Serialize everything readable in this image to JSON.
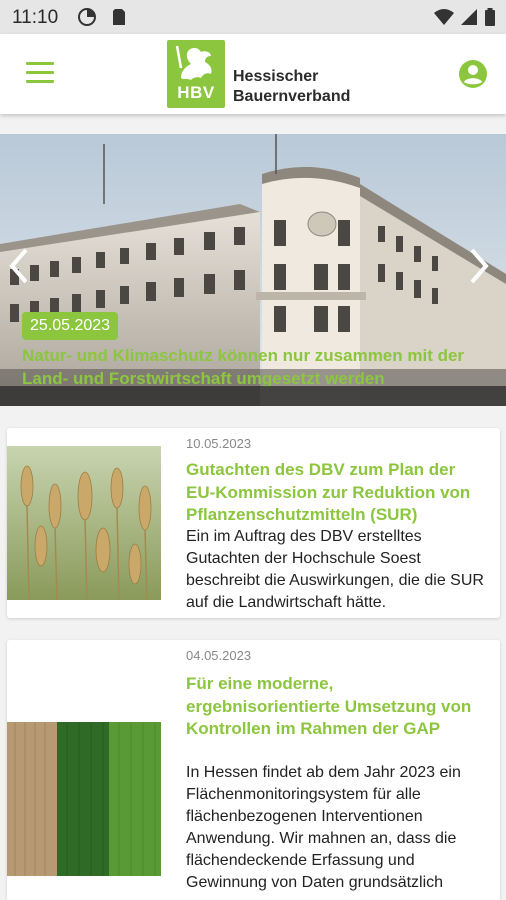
{
  "status_bar": {
    "time": "11:10",
    "icons": [
      "data-saver-icon",
      "sim-card-icon",
      "wifi-icon",
      "cellular-signal-icon",
      "battery-icon"
    ]
  },
  "app_bar": {
    "logo_badge": "HBV",
    "logo_text_line1": "Hessischer",
    "logo_text_line2": "Bauernverband",
    "menu_icon": "hamburger-menu-icon",
    "account_icon": "account-circle-icon",
    "accent_color": "#8cc63e"
  },
  "hero": {
    "date": "25.05.2023",
    "headline": "Natur- und Klimaschutz können nur zusammen mit der Land- und Forstwirtschaft umgesetzt werden",
    "prev_icon": "chevron-left-icon",
    "next_icon": "chevron-right-icon"
  },
  "articles": [
    {
      "date": "10.05.2023",
      "title": "Gutachten des DBV zum Plan der EU-Kommission zur Reduktion von Pflanzenschutzmitteln (SUR)",
      "body": "Ein im Auftrag des DBV erstelltes Gutachten der Hochschule Soest beschreibt die Auswirkungen, die die SUR auf die Landwirtschaft hätte."
    },
    {
      "date": "04.05.2023",
      "title": "Für eine moderne, ergebnisorientierte Umsetzung von Kontrollen im Rahmen der GAP",
      "body": "In Hessen findet ab dem Jahr 2023 ein Flächenmonitoringsystem für alle flächenbezogenen Interventionen Anwendung. Wir mahnen an, dass die flächendeckende Erfassung und Gewinnung von Daten grundsätzlich"
    }
  ]
}
